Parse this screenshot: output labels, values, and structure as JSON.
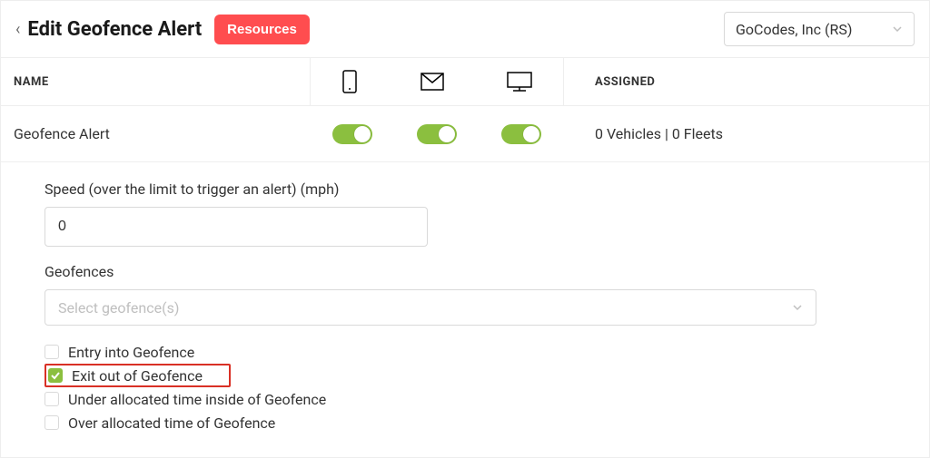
{
  "header": {
    "title": "Edit Geofence Alert",
    "resources_label": "Resources",
    "account_selected": "GoCodes, Inc (RS)"
  },
  "columns": {
    "name": "NAME",
    "assigned": "ASSIGNED"
  },
  "icons": {
    "mobile": "mobile-icon",
    "mail": "mail-icon",
    "desktop": "desktop-icon"
  },
  "row": {
    "name": "Geofence Alert",
    "toggle_mobile": true,
    "toggle_mail": true,
    "toggle_desktop": true,
    "assigned": "0 Vehicles | 0 Fleets"
  },
  "form": {
    "speed_label": "Speed (over the limit to trigger an alert) (mph)",
    "speed_value": "0",
    "geofences_label": "Geofences",
    "geofences_placeholder": "Select geofence(s)",
    "options": [
      {
        "label": "Entry into Geofence",
        "checked": false,
        "highlight": false
      },
      {
        "label": "Exit out of Geofence",
        "checked": true,
        "highlight": true
      },
      {
        "label": "Under allocated time inside of Geofence",
        "checked": false,
        "highlight": false
      },
      {
        "label": "Over allocated time of Geofence",
        "checked": false,
        "highlight": false
      }
    ]
  },
  "colors": {
    "accent_green": "#8bbf3f",
    "accent_red": "#ff4d4f",
    "highlight_border": "#d93025"
  }
}
